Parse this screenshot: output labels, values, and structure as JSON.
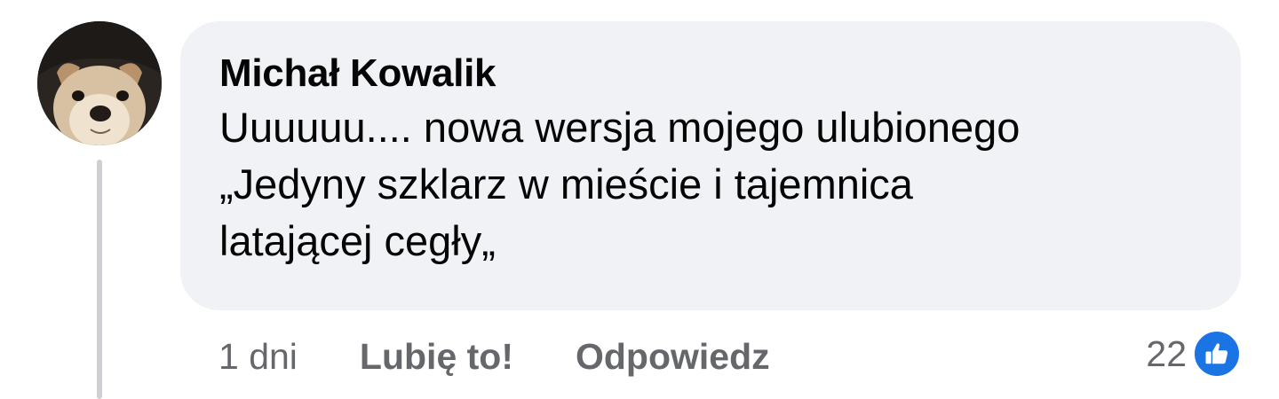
{
  "comment": {
    "author": "Michał Kowalik",
    "text": "Uuuuuu.... nowa wersja mojego ulubionego\n„Jedyny szklarz w mieście i tajemnica\nlatającej cegły„",
    "avatar_icon": "dog-avatar"
  },
  "actions": {
    "time": "1 dni",
    "like_label": "Lubię to!",
    "reply_label": "Odpowiedz"
  },
  "reactions": {
    "count": "22",
    "icon": "thumbs-up-icon",
    "color": "#1b74e4"
  }
}
